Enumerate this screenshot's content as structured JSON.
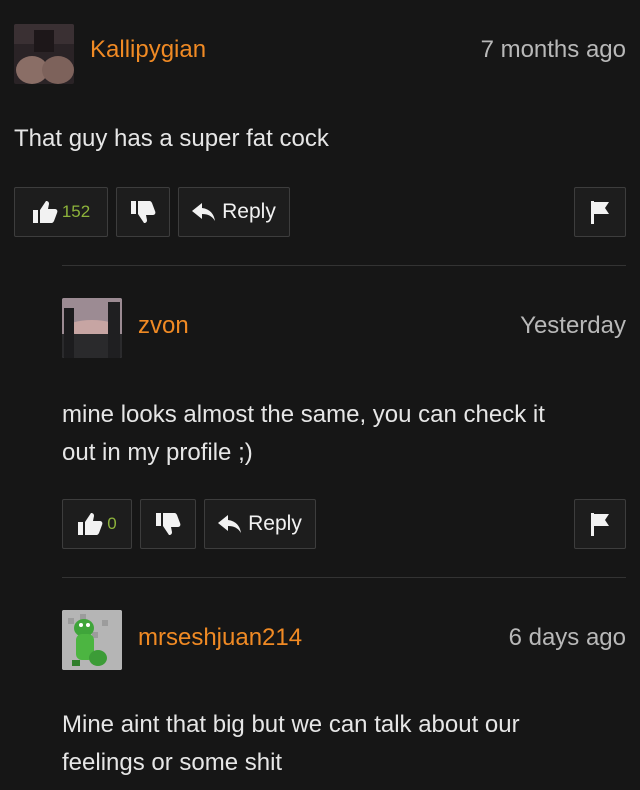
{
  "comments": [
    {
      "username": "Kallipygian",
      "timestamp": "7 months ago",
      "body": "That guy has a super fat cock",
      "upvotes": "152",
      "reply_label": "Reply"
    },
    {
      "username": "zvon",
      "timestamp": "Yesterday",
      "body_line1": "mine looks almost the same, you can check it",
      "body_line2": "out in my profile ;)",
      "upvotes": "0",
      "reply_label": "Reply"
    },
    {
      "username": "mrseshjuan214",
      "timestamp": "6 days ago",
      "body_line1": "Mine aint that big but we can talk about our",
      "body_line2": "feelings or some shit"
    }
  ],
  "colors": {
    "background": "#161616",
    "username": "#f08a24",
    "upvote_count": "#8db33b",
    "button_border": "#3d3d3d"
  }
}
